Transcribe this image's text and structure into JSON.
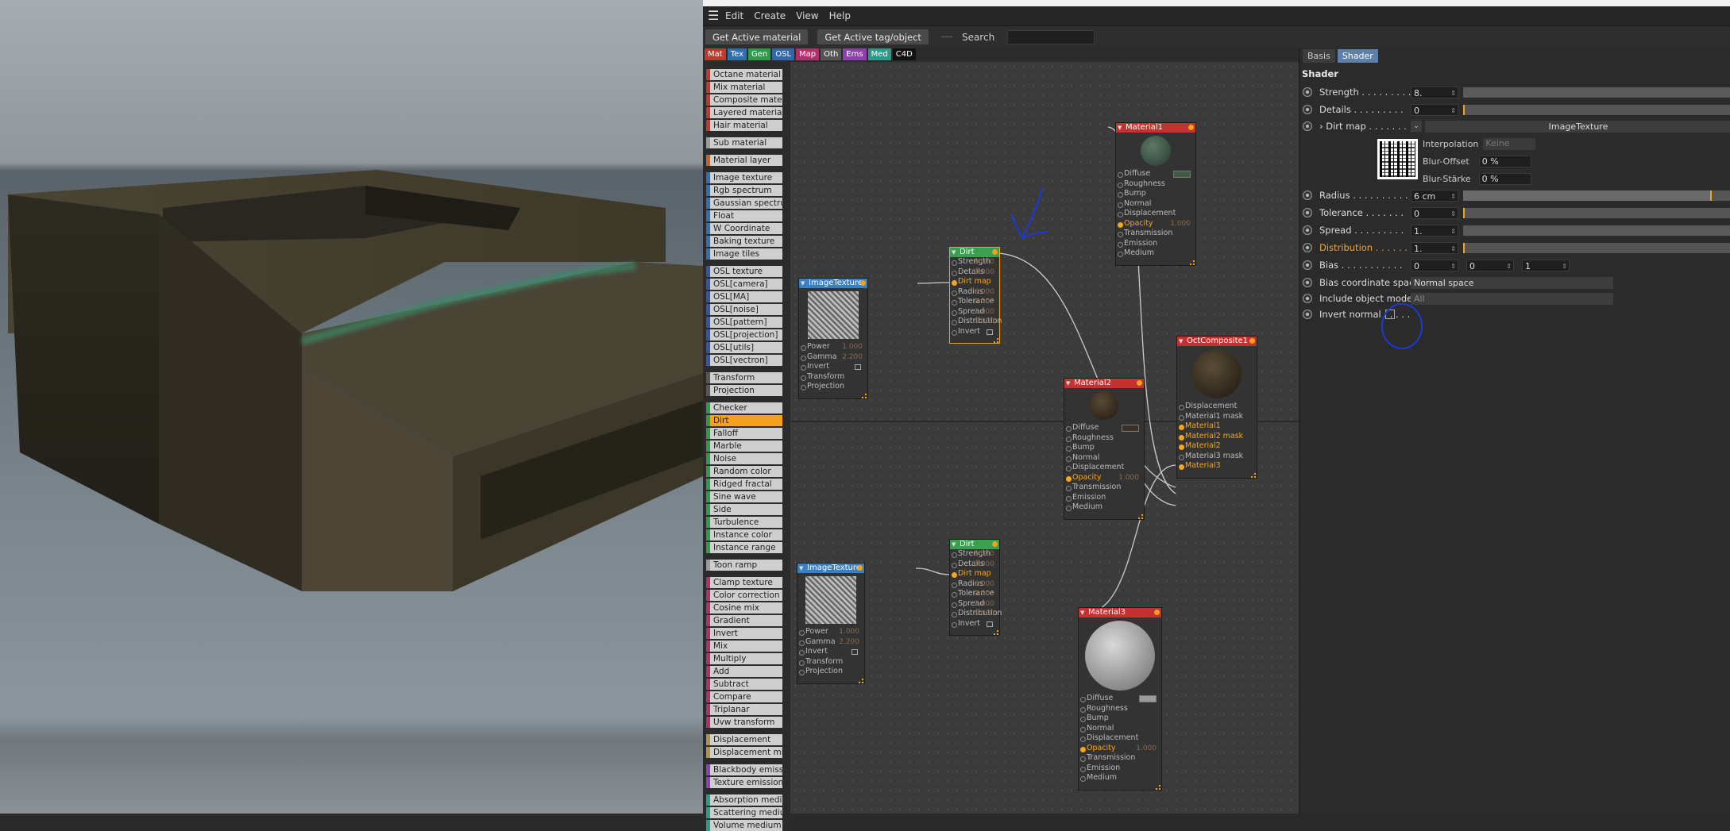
{
  "menu": {
    "items": [
      "Edit",
      "Create",
      "View",
      "Help"
    ]
  },
  "toolbar": {
    "get_material": "Get Active material",
    "get_tag": "Get Active tag/object",
    "search_label": "Search"
  },
  "category_tabs": [
    {
      "label": "Mat",
      "color": "#c0392b"
    },
    {
      "label": "Tex",
      "color": "#2e6fb0"
    },
    {
      "label": "Gen",
      "color": "#2e9a4a"
    },
    {
      "label": "OSL",
      "color": "#3366aa"
    },
    {
      "label": "Map",
      "color": "#b0306a"
    },
    {
      "label": "Oth",
      "color": "#555555"
    },
    {
      "label": "Ems",
      "color": "#8e3fb0"
    },
    {
      "label": "Med",
      "color": "#2b9a8a"
    },
    {
      "label": "C4D",
      "color": "#111111"
    }
  ],
  "node_list": [
    {
      "label": "Octane material",
      "color": "#c0392b"
    },
    {
      "label": "Mix material",
      "color": "#c0392b"
    },
    {
      "label": "Composite material",
      "color": "#c0392b"
    },
    {
      "label": "Layered material",
      "color": "#c0392b"
    },
    {
      "label": "Hair material",
      "color": "#c0392b"
    },
    {
      "label": "Sub material",
      "color": "#9a9a9a"
    },
    {
      "label": "Material layer",
      "color": "#c0662b"
    },
    {
      "label": "Image texture",
      "color": "#2e6fb0"
    },
    {
      "label": "Rgb spectrum",
      "color": "#2e6fb0"
    },
    {
      "label": "Gaussian spectrum",
      "color": "#2e6fb0"
    },
    {
      "label": "Float",
      "color": "#2e6fb0"
    },
    {
      "label": "W Coordinate",
      "color": "#2e6fb0"
    },
    {
      "label": "Baking texture",
      "color": "#2e6fb0"
    },
    {
      "label": "Image tiles",
      "color": "#2e6fb0"
    },
    {
      "label": "OSL texture",
      "color": "#3355a0"
    },
    {
      "label": "OSL[camera]",
      "color": "#3355a0"
    },
    {
      "label": "OSL[MA]",
      "color": "#3355a0"
    },
    {
      "label": "OSL[noise]",
      "color": "#3355a0"
    },
    {
      "label": "OSL[pattern]",
      "color": "#3355a0"
    },
    {
      "label": "OSL[projection]",
      "color": "#3355a0"
    },
    {
      "label": "OSL[utils]",
      "color": "#3355a0"
    },
    {
      "label": "OSL[vectron]",
      "color": "#3355a0"
    },
    {
      "label": "Transform",
      "color": "#555555"
    },
    {
      "label": "Projection",
      "color": "#555555"
    },
    {
      "label": "Checker",
      "color": "#2e9a4a"
    },
    {
      "label": "Dirt",
      "color": "#2e9a4a",
      "selected": true
    },
    {
      "label": "Falloff",
      "color": "#2e9a4a"
    },
    {
      "label": "Marble",
      "color": "#2e9a4a"
    },
    {
      "label": "Noise",
      "color": "#2e9a4a"
    },
    {
      "label": "Random color",
      "color": "#2e9a4a"
    },
    {
      "label": "Ridged fractal",
      "color": "#2e9a4a"
    },
    {
      "label": "Sine wave",
      "color": "#2e9a4a"
    },
    {
      "label": "Side",
      "color": "#2e9a4a"
    },
    {
      "label": "Turbulence",
      "color": "#2e9a4a"
    },
    {
      "label": "Instance color",
      "color": "#2e9a4a"
    },
    {
      "label": "Instance range",
      "color": "#2e9a4a"
    },
    {
      "label": "Toon ramp",
      "color": "#9a9a9a"
    },
    {
      "label": "Clamp texture",
      "color": "#b0306a"
    },
    {
      "label": "Color correction",
      "color": "#b0306a"
    },
    {
      "label": "Cosine mix",
      "color": "#b0306a"
    },
    {
      "label": "Gradient",
      "color": "#b0306a"
    },
    {
      "label": "Invert",
      "color": "#b0306a"
    },
    {
      "label": "Mix",
      "color": "#b0306a"
    },
    {
      "label": "Multiply",
      "color": "#b0306a"
    },
    {
      "label": "Add",
      "color": "#b0306a"
    },
    {
      "label": "Subtract",
      "color": "#b0306a"
    },
    {
      "label": "Compare",
      "color": "#b0306a"
    },
    {
      "label": "Triplanar",
      "color": "#b0306a"
    },
    {
      "label": "Uvw transform",
      "color": "#b0306a"
    },
    {
      "label": "Displacement",
      "color": "#b39050"
    },
    {
      "label": "Displacement mixer",
      "color": "#b39050"
    },
    {
      "label": "Blackbody emission",
      "color": "#8e3fb0"
    },
    {
      "label": "Texture emission",
      "color": "#8e3fb0"
    },
    {
      "label": "Absorption medium",
      "color": "#2b9a8a"
    },
    {
      "label": "Scattering medium",
      "color": "#2b9a8a"
    },
    {
      "label": "Volume medium",
      "color": "#2b9a8a"
    }
  ],
  "nodes": {
    "imgtex1": {
      "title": "ImageTexture",
      "rows": [
        {
          "l": "Power",
          "v": "1.000"
        },
        {
          "l": "Gamma",
          "v": "2.200"
        },
        {
          "l": "Invert",
          "chk": true
        },
        {
          "l": "Transform"
        },
        {
          "l": "Projection"
        }
      ]
    },
    "dirt1": {
      "title": "Dirt",
      "rows": [
        {
          "l": "Strength",
          "v": "8.000"
        },
        {
          "l": "Details",
          "v": "0.000"
        },
        {
          "l": "Dirt map",
          "act": true
        },
        {
          "l": "Radius",
          "v": "6.000"
        },
        {
          "l": "Tolerance",
          "v": "0.000"
        },
        {
          "l": "Spread",
          "v": "1.000"
        },
        {
          "l": "Distribution",
          "v": "1.000"
        },
        {
          "l": "Invert",
          "chk": true
        }
      ]
    },
    "mat1": {
      "title": "Material1",
      "rows": [
        {
          "l": "Diffuse",
          "sw": "#3e5a45"
        },
        {
          "l": "Roughness"
        },
        {
          "l": "Bump"
        },
        {
          "l": "Normal"
        },
        {
          "l": "Displacement"
        },
        {
          "l": "Opacity",
          "v": "1.000",
          "act": true
        },
        {
          "l": "Transmission"
        },
        {
          "l": "Emission"
        },
        {
          "l": "Medium"
        }
      ]
    },
    "mat2": {
      "title": "Material2",
      "rows": [
        {
          "l": "Diffuse",
          "sw": "#3a3124"
        },
        {
          "l": "Roughness"
        },
        {
          "l": "Bump"
        },
        {
          "l": "Normal"
        },
        {
          "l": "Displacement"
        },
        {
          "l": "Opacity",
          "v": "1.000",
          "act": true
        },
        {
          "l": "Transmission"
        },
        {
          "l": "Emission"
        },
        {
          "l": "Medium"
        }
      ]
    },
    "comp": {
      "title": "OctComposite1",
      "rows": [
        {
          "l": "Displacement"
        },
        {
          "l": "Material1 mask"
        },
        {
          "l": "Material1",
          "act": true
        },
        {
          "l": "Material2 mask",
          "act": true
        },
        {
          "l": "Material2",
          "act": true
        },
        {
          "l": "Material3 mask"
        },
        {
          "l": "Material3",
          "act": true
        }
      ]
    },
    "imgtex2": {
      "title": "ImageTexture",
      "rows": [
        {
          "l": "Power",
          "v": "1.000"
        },
        {
          "l": "Gamma",
          "v": "2.200"
        },
        {
          "l": "Invert",
          "chk": true
        },
        {
          "l": "Transform"
        },
        {
          "l": "Projection"
        }
      ]
    },
    "dirt2": {
      "title": "Dirt",
      "rows": [
        {
          "l": "Strength",
          "v": "8.000"
        },
        {
          "l": "Details",
          "v": "0.000"
        },
        {
          "l": "Dirt map",
          "act": true
        },
        {
          "l": "Radius",
          "v": "6.000"
        },
        {
          "l": "Tolerance",
          "v": "0.000"
        },
        {
          "l": "Spread",
          "v": "1.000"
        },
        {
          "l": "Distribution",
          "v": "1.000"
        },
        {
          "l": "Invert",
          "chk": true
        }
      ]
    },
    "mat3": {
      "title": "Material3",
      "rows": [
        {
          "l": "Diffuse",
          "sw": "#9a9a9a"
        },
        {
          "l": "Roughness"
        },
        {
          "l": "Bump"
        },
        {
          "l": "Normal"
        },
        {
          "l": "Displacement"
        },
        {
          "l": "Opacity",
          "v": "1.000",
          "act": true
        },
        {
          "l": "Transmission"
        },
        {
          "l": "Emission"
        },
        {
          "l": "Medium"
        }
      ]
    }
  },
  "attributes": {
    "tabs": [
      "Basis",
      "Shader"
    ],
    "section": "Shader",
    "strength": {
      "label": "Strength . . . . . . . . .",
      "value": "8.",
      "fill": 0
    },
    "details": {
      "label": "Details . . . . . . . . .",
      "value": "0",
      "fill": 0
    },
    "dirtmap": {
      "label": "› Dirt map . . . . . . .",
      "value": "ImageTexture"
    },
    "interp": {
      "label": "Interpolation",
      "value": "Keine"
    },
    "bluroff": {
      "label": "Blur-Offset",
      "value": "0 %"
    },
    "blurst": {
      "label": "Blur-Stärke",
      "value": "0 %"
    },
    "radius": {
      "label": "Radius . . . . . . . . . .",
      "value": "6 cm",
      "fill": 0.92
    },
    "tolerance": {
      "label": "Tolerance . . . . . . .",
      "value": "0",
      "fill": 0
    },
    "spread": {
      "label": "Spread . . . . . . . . .",
      "value": "1.",
      "fill": 1
    },
    "distribution": {
      "label": "Distribution . . . . . .",
      "value": "1.",
      "fill": 0
    },
    "bias": {
      "label": "Bias . . . . . . . . . . .",
      "v1": "0",
      "v2": "0",
      "v3": "1"
    },
    "biascoord": {
      "label": "Bias coordinate space",
      "value": "Normal space"
    },
    "includeobj": {
      "label": "Include object mode",
      "value": "All"
    },
    "invertnormal": {
      "label": "Invert normal . . . . ."
    }
  }
}
